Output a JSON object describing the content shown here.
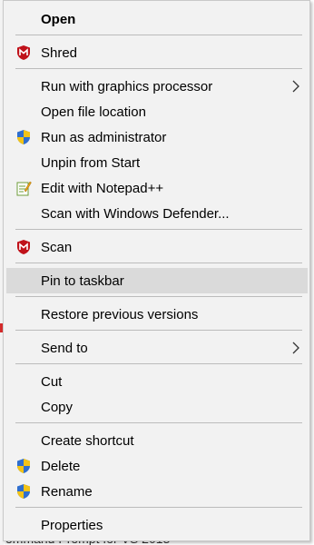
{
  "background": {
    "bottom_text": "ommand Prompt for VS 2013"
  },
  "menu": {
    "items": [
      {
        "label": "Open",
        "bold": true
      },
      {
        "label": "Shred",
        "icon": "mcafee-icon"
      },
      {
        "label": "Run with graphics processor",
        "submenu": true
      },
      {
        "label": "Open file location"
      },
      {
        "label": "Run as administrator",
        "icon": "uac-shield-icon"
      },
      {
        "label": "Unpin from Start"
      },
      {
        "label": "Edit with Notepad++",
        "icon": "notepad-plus-plus-icon"
      },
      {
        "label": "Scan with Windows Defender..."
      },
      {
        "label": "Scan",
        "icon": "mcafee-icon"
      },
      {
        "label": "Pin to taskbar",
        "highlighted": true
      },
      {
        "label": "Restore previous versions"
      },
      {
        "label": "Send to",
        "submenu": true
      },
      {
        "label": "Cut"
      },
      {
        "label": "Copy"
      },
      {
        "label": "Create shortcut"
      },
      {
        "label": "Delete",
        "icon": "uac-shield-icon"
      },
      {
        "label": "Rename",
        "icon": "uac-shield-icon"
      },
      {
        "label": "Properties"
      }
    ]
  },
  "colors": {
    "menu_bg": "#f2f2f2",
    "highlight": "#dadada",
    "separator": "#bcbcbc",
    "mcafee_red": "#c0121a",
    "shield_blue": "#2f6fcf",
    "shield_yellow": "#f3c316"
  }
}
